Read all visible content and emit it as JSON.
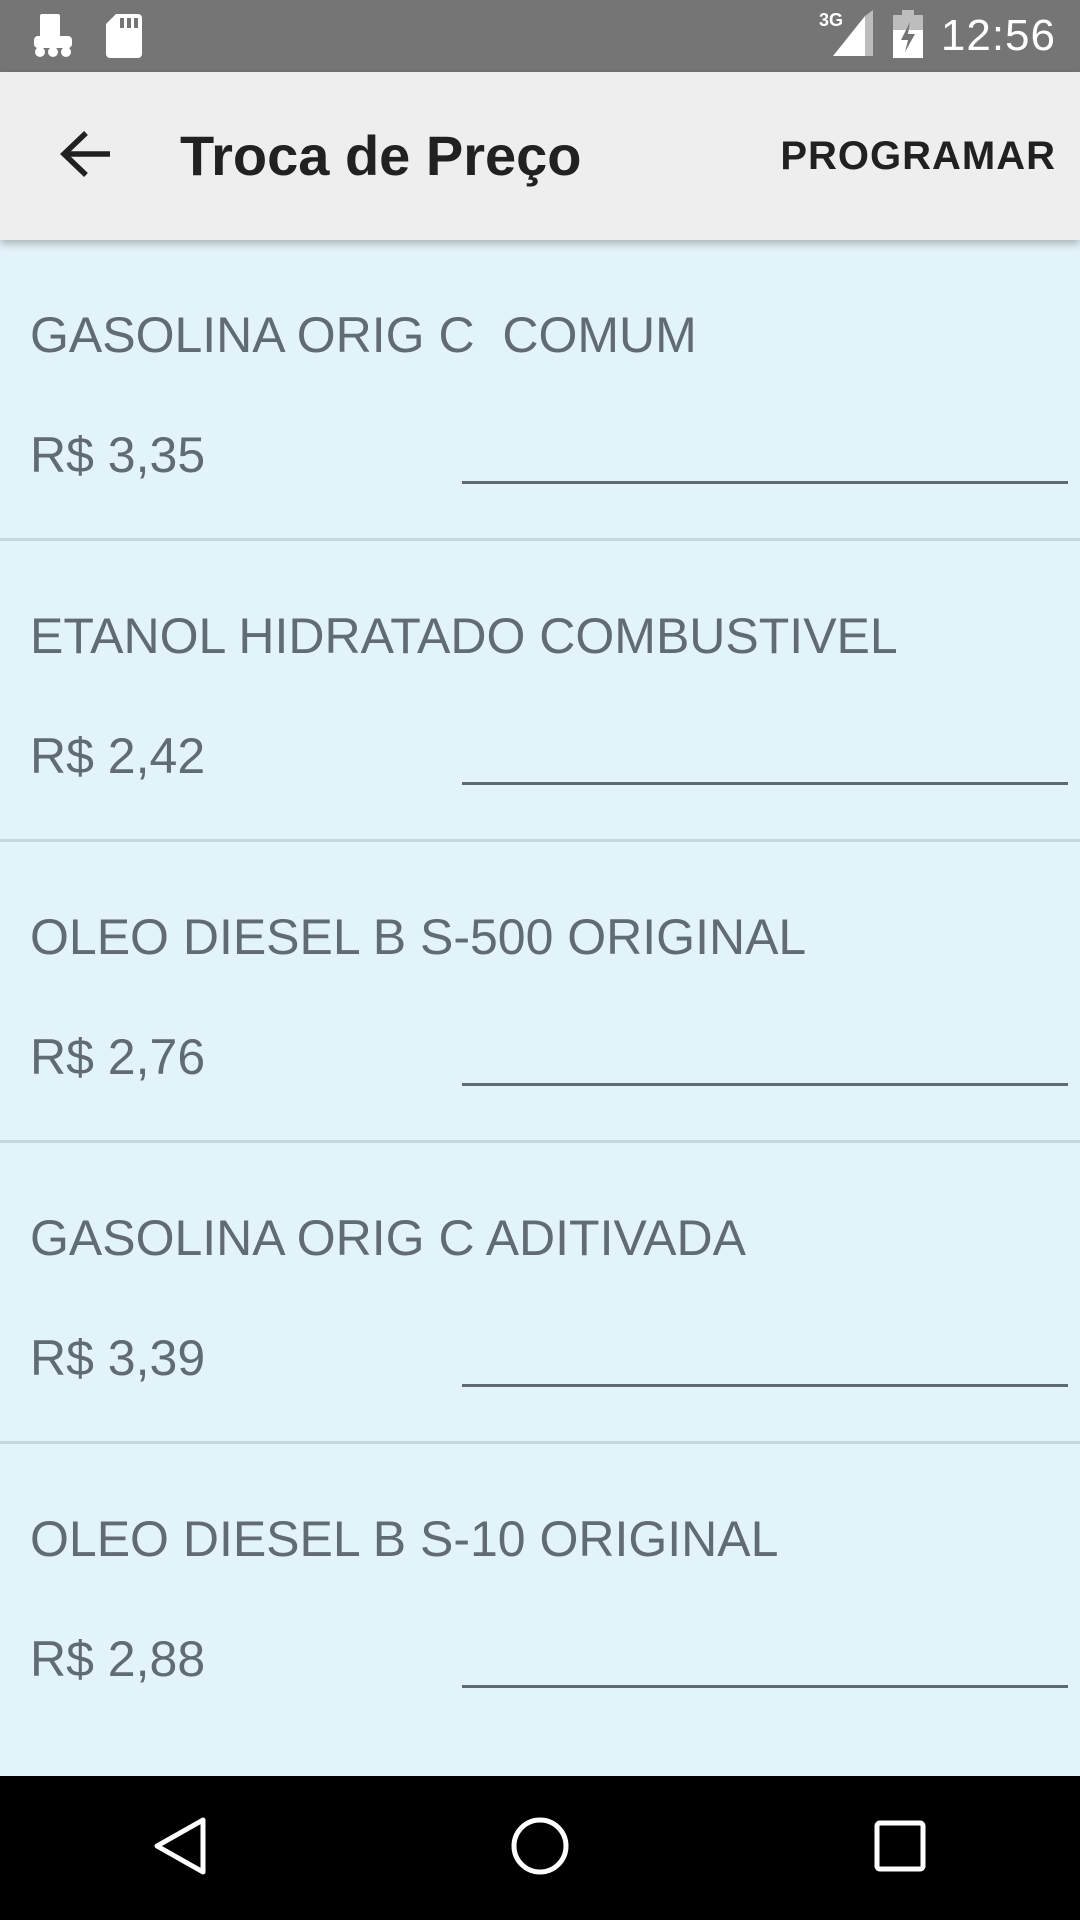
{
  "status_bar": {
    "time": "12:56",
    "network": "3G",
    "icons": [
      "notification-app-icon",
      "sd-card-icon",
      "signal-icon",
      "battery-charging-icon"
    ]
  },
  "app_bar": {
    "title": "Troca de Preço",
    "action_label": "PROGRAMAR",
    "back_icon": "arrow-back-icon"
  },
  "products": [
    {
      "name": "GASOLINA ORIG C  COMUM",
      "price": "R$ 3,35",
      "new_price": ""
    },
    {
      "name": "ETANOL HIDRATADO COMBUSTIVEL",
      "price": "R$ 2,42",
      "new_price": ""
    },
    {
      "name": "OLEO DIESEL B S-500 ORIGINAL",
      "price": "R$ 2,76",
      "new_price": ""
    },
    {
      "name": "GASOLINA ORIG C ADITIVADA",
      "price": "R$ 3,39",
      "new_price": ""
    },
    {
      "name": "OLEO DIESEL B S-10 ORIGINAL",
      "price": "R$ 2,88",
      "new_price": ""
    }
  ],
  "nav_bar": {
    "icons": [
      "back-triangle-icon",
      "home-circle-icon",
      "recents-square-icon"
    ]
  },
  "colors": {
    "status_bar": "#757575",
    "app_bar": "#EEEEEE",
    "list_background": "#E3F4F9",
    "text": "#616B73",
    "nav_bar": "#000000"
  }
}
